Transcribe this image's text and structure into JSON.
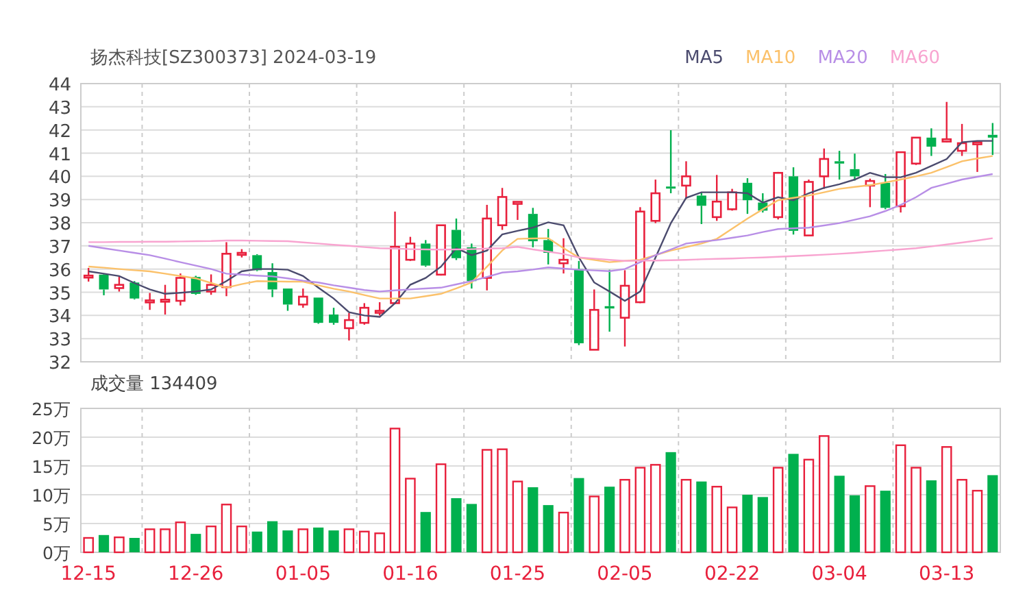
{
  "price_chart": {
    "chart_data": {
      "type": "candlestick",
      "title": "扬杰科技[SZ300373] 2024-03-19",
      "grid": true,
      "ylim": [
        32,
        44
      ],
      "yticks": [
        32,
        33,
        34,
        35,
        36,
        37,
        38,
        39,
        40,
        41,
        42,
        43,
        44
      ],
      "categories": [
        null,
        null,
        null,
        null,
        null,
        null,
        null,
        null,
        null,
        null,
        null,
        null,
        null,
        null,
        null,
        null,
        null,
        null,
        null,
        null,
        null,
        null,
        null,
        null,
        null,
        null,
        null,
        null,
        null,
        null,
        null,
        null,
        null,
        null,
        null,
        null,
        null,
        null,
        null,
        null,
        null,
        null,
        null,
        null,
        null,
        null,
        null,
        null,
        null,
        null,
        null,
        null,
        null,
        null,
        null,
        null,
        null,
        null,
        null,
        null
      ],
      "ohlc": [
        [
          35.68,
          36.05,
          35.46,
          35.72
        ],
        [
          35.76,
          35.78,
          34.87,
          35.12
        ],
        [
          35.18,
          35.68,
          35.03,
          35.32
        ],
        [
          35.42,
          35.48,
          34.69,
          34.73
        ],
        [
          34.63,
          34.97,
          34.24,
          34.65
        ],
        [
          34.65,
          35.32,
          34.04,
          34.68
        ],
        [
          34.63,
          35.81,
          34.43,
          35.62
        ],
        [
          35.66,
          35.71,
          34.89,
          34.93
        ],
        [
          35.03,
          35.77,
          34.89,
          35.32
        ],
        [
          35.22,
          37.16,
          34.83,
          36.66
        ],
        [
          36.66,
          36.86,
          36.5,
          36.7
        ],
        [
          36.6,
          36.64,
          35.91,
          35.95
        ],
        [
          35.87,
          36.25,
          34.79,
          35.12
        ],
        [
          35.16,
          35.16,
          34.2,
          34.47
        ],
        [
          34.47,
          35.16,
          34.33,
          34.81
        ],
        [
          34.77,
          34.77,
          33.64,
          33.68
        ],
        [
          34.04,
          34.33,
          33.6,
          33.68
        ],
        [
          33.45,
          34.1,
          32.92,
          33.8
        ],
        [
          33.68,
          34.53,
          33.6,
          34.33
        ],
        [
          34.15,
          34.57,
          34.0,
          34.2
        ],
        [
          34.53,
          38.48,
          34.49,
          36.96
        ],
        [
          36.4,
          37.39,
          36.35,
          37.1
        ],
        [
          37.1,
          37.25,
          36.1,
          36.15
        ],
        [
          35.76,
          37.9,
          35.72,
          37.89
        ],
        [
          37.69,
          38.18,
          36.39,
          36.47
        ],
        [
          36.94,
          37.1,
          35.16,
          35.48
        ],
        [
          35.62,
          38.77,
          35.08,
          38.18
        ],
        [
          37.89,
          39.5,
          37.69,
          39.11
        ],
        [
          38.85,
          38.9,
          38.12,
          38.9
        ],
        [
          38.38,
          38.64,
          36.94,
          37.2
        ],
        [
          37.25,
          37.73,
          36.2,
          36.7
        ],
        [
          36.25,
          37.33,
          35.81,
          36.4
        ],
        [
          36.0,
          36.35,
          32.72,
          32.8
        ],
        [
          32.52,
          35.12,
          32.52,
          34.24
        ],
        [
          34.4,
          35.97,
          33.3,
          34.3
        ],
        [
          33.9,
          35.95,
          32.66,
          35.28
        ],
        [
          34.57,
          38.67,
          34.53,
          38.48
        ],
        [
          38.08,
          39.86,
          37.98,
          39.27
        ],
        [
          39.56,
          41.99,
          39.27,
          39.48
        ],
        [
          39.6,
          40.65,
          39.03,
          40.0
        ],
        [
          39.17,
          39.31,
          37.94,
          38.73
        ],
        [
          38.24,
          40.06,
          38.08,
          38.91
        ],
        [
          38.58,
          39.46,
          38.52,
          39.31
        ],
        [
          39.72,
          39.92,
          38.38,
          38.97
        ],
        [
          38.87,
          39.27,
          38.44,
          38.52
        ],
        [
          38.24,
          40.19,
          38.14,
          40.15
        ],
        [
          40.0,
          40.39,
          37.49,
          37.65
        ],
        [
          37.45,
          39.86,
          37.45,
          39.76
        ],
        [
          40.0,
          41.2,
          39.46,
          40.75
        ],
        [
          40.65,
          41.1,
          39.86,
          40.55
        ],
        [
          40.31,
          40.98,
          39.82,
          40.0
        ],
        [
          39.6,
          39.9,
          38.67,
          39.8
        ],
        [
          39.72,
          40.1,
          38.58,
          38.64
        ],
        [
          38.71,
          41.04,
          38.44,
          41.04
        ],
        [
          40.55,
          41.67,
          40.49,
          41.67
        ],
        [
          41.67,
          42.07,
          40.88,
          41.28
        ],
        [
          41.5,
          43.21,
          41.47,
          41.6
        ],
        [
          41.1,
          42.26,
          40.88,
          41.43
        ],
        [
          41.4,
          41.47,
          40.19,
          41.47
        ],
        [
          41.79,
          42.3,
          40.92,
          41.67
        ]
      ],
      "series": [
        {
          "name": "MA5",
          "type": "line",
          "color": "#4b4b6e",
          "values": [
            35.9,
            35.8,
            35.7,
            35.4,
            35.12,
            34.93,
            34.98,
            35.03,
            35.12,
            35.48,
            35.9,
            36.0,
            36.0,
            35.97,
            35.7,
            35.2,
            34.73,
            34.14,
            34.0,
            33.94,
            34.53,
            35.32,
            35.62,
            36.1,
            36.9,
            36.6,
            36.8,
            37.49,
            37.65,
            37.79,
            38.02,
            37.89,
            36.5,
            35.42,
            35.03,
            34.63,
            35.03,
            36.5,
            37.98,
            39.07,
            39.31,
            39.31,
            39.31,
            39.27,
            38.87,
            39.1,
            38.97,
            39.27,
            39.5,
            39.66,
            39.86,
            40.15,
            39.96,
            39.96,
            40.15,
            40.45,
            40.75,
            41.47,
            41.53,
            41.53
          ]
        },
        {
          "name": "MA10",
          "type": "line",
          "color": "#fbc16a",
          "values": [
            36.11,
            36.06,
            36.0,
            35.95,
            35.9,
            35.8,
            35.7,
            35.6,
            35.4,
            35.2,
            35.35,
            35.48,
            35.47,
            35.46,
            35.46,
            35.3,
            35.15,
            35.03,
            34.88,
            34.73,
            34.73,
            34.73,
            34.83,
            34.93,
            35.17,
            35.42,
            36.1,
            36.8,
            37.3,
            37.32,
            37.33,
            36.9,
            36.5,
            36.4,
            36.3,
            36.35,
            36.4,
            36.6,
            36.8,
            36.95,
            37.1,
            37.3,
            37.74,
            38.18,
            38.58,
            38.97,
            39.07,
            39.17,
            39.31,
            39.46,
            39.54,
            39.62,
            39.74,
            39.86,
            40.0,
            40.15,
            40.4,
            40.65,
            40.77,
            40.88
          ]
        },
        {
          "name": "MA20",
          "type": "line",
          "color": "#b88ee6",
          "values": [
            37.0,
            36.9,
            36.8,
            36.7,
            36.6,
            36.45,
            36.3,
            36.15,
            36.0,
            35.8,
            35.76,
            35.72,
            35.68,
            35.6,
            35.5,
            35.42,
            35.3,
            35.2,
            35.1,
            35.03,
            35.08,
            35.12,
            35.16,
            35.2,
            35.34,
            35.48,
            35.66,
            35.85,
            35.9,
            35.98,
            36.07,
            36.02,
            35.97,
            35.94,
            35.91,
            36.0,
            36.3,
            36.6,
            36.85,
            37.1,
            37.18,
            37.25,
            37.35,
            37.45,
            37.6,
            37.73,
            37.76,
            37.79,
            37.88,
            37.98,
            38.13,
            38.28,
            38.5,
            38.77,
            39.1,
            39.5,
            39.68,
            39.86,
            39.98,
            40.1
          ]
        },
        {
          "name": "MA60",
          "type": "line",
          "color": "#f8a4d0",
          "values": [
            37.16,
            37.16,
            37.17,
            37.17,
            37.18,
            37.18,
            37.19,
            37.2,
            37.21,
            37.23,
            37.23,
            37.22,
            37.21,
            37.2,
            37.15,
            37.1,
            37.05,
            37.0,
            36.95,
            36.9,
            36.88,
            36.86,
            36.85,
            36.84,
            36.85,
            36.86,
            36.88,
            36.9,
            36.96,
            36.85,
            36.75,
            36.65,
            36.5,
            36.45,
            36.4,
            36.35,
            36.36,
            36.37,
            36.38,
            36.4,
            36.42,
            36.44,
            36.46,
            36.48,
            36.5,
            36.53,
            36.56,
            36.59,
            36.62,
            36.66,
            36.7,
            36.75,
            36.8,
            36.85,
            36.9,
            36.98,
            37.06,
            37.14,
            37.23,
            37.33
          ]
        }
      ]
    }
  },
  "volume_chart": {
    "chart_data": {
      "type": "bar",
      "title": "成交量 134409",
      "grid": true,
      "ylim": [
        0,
        25
      ],
      "yticks": [
        {
          "value": 0,
          "label": "0万"
        },
        {
          "value": 5,
          "label": "5万"
        },
        {
          "value": 10,
          "label": "10万"
        },
        {
          "value": 15,
          "label": "15万"
        },
        {
          "value": 20,
          "label": "20万"
        },
        {
          "value": 25,
          "label": "25万"
        }
      ],
      "categories": [
        "12-15",
        null,
        null,
        null,
        null,
        null,
        null,
        "12-26",
        null,
        null,
        null,
        null,
        null,
        null,
        "01-05",
        null,
        null,
        null,
        null,
        null,
        null,
        "01-16",
        null,
        null,
        null,
        null,
        null,
        null,
        "01-25",
        null,
        null,
        null,
        null,
        null,
        null,
        "02-05",
        null,
        null,
        null,
        null,
        null,
        null,
        "02-22",
        null,
        null,
        null,
        null,
        null,
        null,
        "03-04",
        null,
        null,
        null,
        null,
        null,
        null,
        "03-13",
        null,
        null,
        null
      ],
      "values": [
        2.5,
        3,
        2.6,
        2.5,
        4,
        4,
        5.2,
        3.2,
        4.5,
        8.3,
        4.5,
        3.6,
        5.4,
        3.8,
        4,
        4.3,
        3.8,
        4,
        3.6,
        3.3,
        21.5,
        12.8,
        7,
        15.3,
        9.4,
        8.4,
        17.8,
        17.9,
        12.3,
        11.3,
        8.2,
        6.9,
        12.9,
        9.7,
        11.4,
        12.6,
        14.7,
        15.2,
        17.4,
        12.6,
        12.3,
        11.4,
        7.8,
        10,
        9.6,
        14.7,
        17.1,
        16.1,
        20.2,
        13.3,
        9.9,
        11.5,
        10.7,
        18.6,
        14.7,
        12.5,
        18.3,
        12.6,
        10.7,
        13.4
      ]
    }
  }
}
